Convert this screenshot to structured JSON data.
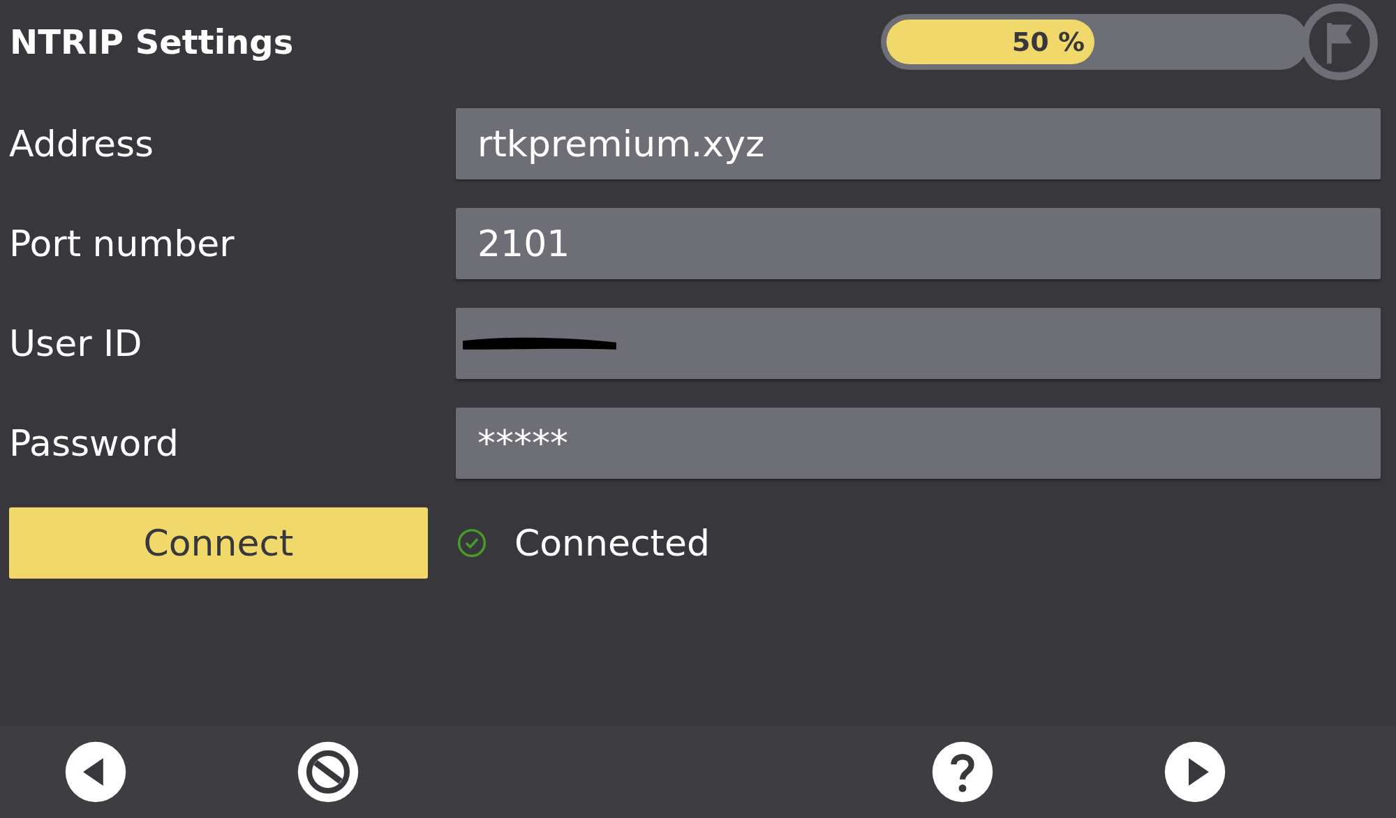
{
  "header": {
    "title": "NTRIP Settings",
    "progress": {
      "level": 0.5,
      "reading": "50 %"
    }
  },
  "fields": [
    {
      "label": "Address",
      "value": "rtkpremium.xyz",
      "redacted": false
    },
    {
      "label": "Port number",
      "value": "2101",
      "redacted": false
    },
    {
      "label": "User ID",
      "redacted": true
    },
    {
      "label": "Password",
      "value": "*****",
      "redacted": false
    }
  ],
  "connect_button": "Connect",
  "status": {
    "text": "Connected",
    "connected": true
  },
  "bottom_bar": [
    {
      "kind": "back"
    },
    {
      "kind": "cancel"
    },
    {
      "kind": "spacer"
    },
    {
      "kind": "help"
    },
    {
      "kind": "next"
    }
  ]
}
